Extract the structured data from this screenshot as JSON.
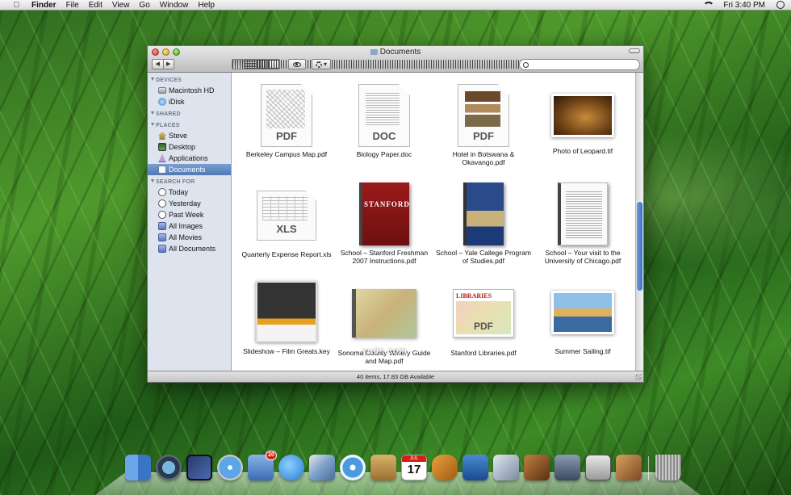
{
  "menubar": {
    "app_name": "Finder",
    "menus": [
      "File",
      "Edit",
      "View",
      "Go",
      "Window",
      "Help"
    ],
    "clock": "Fri 3:40 PM"
  },
  "window": {
    "title": "Documents",
    "search_placeholder": "",
    "status": "40 items, 17.83 GB Available"
  },
  "sidebar": {
    "sections": [
      {
        "title": "DEVICES",
        "items": [
          {
            "label": "Macintosh HD",
            "icon": "hard-drive-icon"
          },
          {
            "label": "iDisk",
            "icon": "idisk-icon"
          }
        ]
      },
      {
        "title": "SHARED",
        "items": []
      },
      {
        "title": "PLACES",
        "items": [
          {
            "label": "Steve",
            "icon": "home-icon"
          },
          {
            "label": "Desktop",
            "icon": "desktop-icon"
          },
          {
            "label": "Applications",
            "icon": "applications-icon"
          },
          {
            "label": "Documents",
            "icon": "documents-icon",
            "selected": true
          }
        ]
      },
      {
        "title": "SEARCH FOR",
        "items": [
          {
            "label": "Today",
            "icon": "clock-icon"
          },
          {
            "label": "Yesterday",
            "icon": "clock-icon"
          },
          {
            "label": "Past Week",
            "icon": "clock-icon"
          },
          {
            "label": "All Images",
            "icon": "smart-folder-icon"
          },
          {
            "label": "All Movies",
            "icon": "smart-folder-icon"
          },
          {
            "label": "All Documents",
            "icon": "smart-folder-icon"
          }
        ]
      }
    ]
  },
  "files": [
    {
      "name": "Berkeley Campus Map.pdf",
      "kind": "PDF"
    },
    {
      "name": "Biology Paper.doc",
      "kind": "DOC"
    },
    {
      "name": "Hotel in Botswana & Okavango.pdf",
      "kind": "PDF"
    },
    {
      "name": "Photo of Leopard.tif",
      "kind": ""
    },
    {
      "name": "Quarterly Expense Report.xls",
      "kind": "XLS"
    },
    {
      "name": "School – Stanford Freshman 2007 Instructions.pdf",
      "kind": "",
      "cover_text": "STANFORD"
    },
    {
      "name": "School – Yale Callege Program of Studies.pdf",
      "kind": ""
    },
    {
      "name": "School – Your visit to the University of Chicago.pdf",
      "kind": ""
    },
    {
      "name": "Slideshow – Film Greats.key",
      "kind": ""
    },
    {
      "name": "Sonoma County Winery Guide and Map.pdf",
      "kind": ""
    },
    {
      "name": "Stanford Libraries.pdf",
      "kind": "PDF",
      "cover_text": "LIBRARIES"
    },
    {
      "name": "Summer Sailing.tif",
      "kind": ""
    }
  ],
  "watermark": "yudn.com",
  "dock": {
    "mail_badge": "20",
    "calendar_month": "JUL",
    "calendar_day": "17",
    "apps": [
      "finder-icon",
      "time-machine-icon",
      "dashboard-icon",
      "safari-icon",
      "mail-icon",
      "ichat-icon",
      "iphoto-icon",
      "itunes-icon",
      "address-book-icon",
      "ical-icon",
      "garageband-icon",
      "keynote-icon",
      "preview-icon",
      "photo-booth-icon",
      "imovie-icon",
      "system-preferences-icon",
      "iweb-icon",
      "trash-icon"
    ]
  }
}
